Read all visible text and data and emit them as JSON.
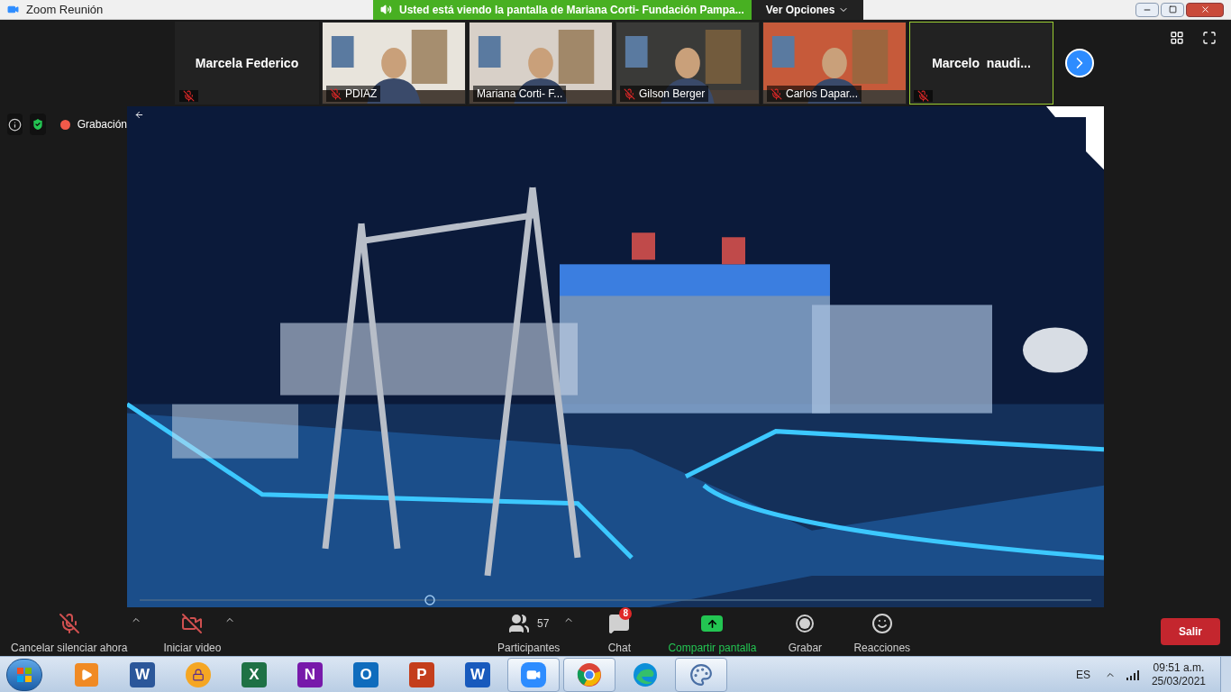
{
  "window": {
    "title": "Zoom Reunión"
  },
  "share_banner": {
    "text": "Usted está viendo la pantalla de Mariana Corti- Fundación Pampa...",
    "options": "Ver Opciones"
  },
  "participants": [
    {
      "name": "Marcela Federico",
      "kind": "name",
      "muted": true,
      "speaking": false
    },
    {
      "name": "PDIAZ",
      "kind": "video",
      "muted": true,
      "speaking": false
    },
    {
      "name": "Mariana Corti- F...",
      "kind": "video",
      "muted": false,
      "speaking": false
    },
    {
      "name": "Gilson Berger",
      "kind": "video",
      "muted": true,
      "speaking": false
    },
    {
      "name": "Carlos Dapar...",
      "kind": "video",
      "muted": true,
      "speaking": false
    },
    {
      "name": "Marcelo  naudi...",
      "kind": "name",
      "muted": true,
      "speaking": true
    }
  ],
  "recording": {
    "label": "Grabación"
  },
  "toolbar": [
    {
      "kind": "mic",
      "label": "Cancelar silenciar ahora",
      "crossed": true,
      "caret": true
    },
    {
      "kind": "video",
      "label": "Iniciar video",
      "crossed": true,
      "caret": true
    },
    {
      "kind": "participants",
      "label": "Participantes",
      "count": "57",
      "caret": true
    },
    {
      "kind": "chat",
      "label": "Chat",
      "badge": "8"
    },
    {
      "kind": "share",
      "label": "Compartir pantalla"
    },
    {
      "kind": "record",
      "label": "Grabar"
    },
    {
      "kind": "reactions",
      "label": "Reacciones"
    }
  ],
  "leave_button": "Salir",
  "taskbar": {
    "apps": [
      {
        "kind": "media",
        "open": false
      },
      {
        "kind": "letter",
        "letter": "W",
        "color": "#2b579a",
        "open": false
      },
      {
        "kind": "lock",
        "open": false
      },
      {
        "kind": "letter",
        "letter": "X",
        "color": "#1e7145",
        "open": false
      },
      {
        "kind": "letter",
        "letter": "N",
        "color": "#7719aa",
        "open": false
      },
      {
        "kind": "letter",
        "letter": "O",
        "color": "#0f6cbd",
        "open": false
      },
      {
        "kind": "letter",
        "letter": "P",
        "color": "#c43e1c",
        "open": false
      },
      {
        "kind": "letter",
        "letter": "W",
        "color": "#185abd",
        "open": false
      },
      {
        "kind": "camera",
        "open": true
      },
      {
        "kind": "browser",
        "open": true
      },
      {
        "kind": "edge",
        "open": false
      },
      {
        "kind": "palette",
        "open": true
      }
    ],
    "language": "ES",
    "time": "09:51 a.m.",
    "date": "25/03/2021"
  }
}
